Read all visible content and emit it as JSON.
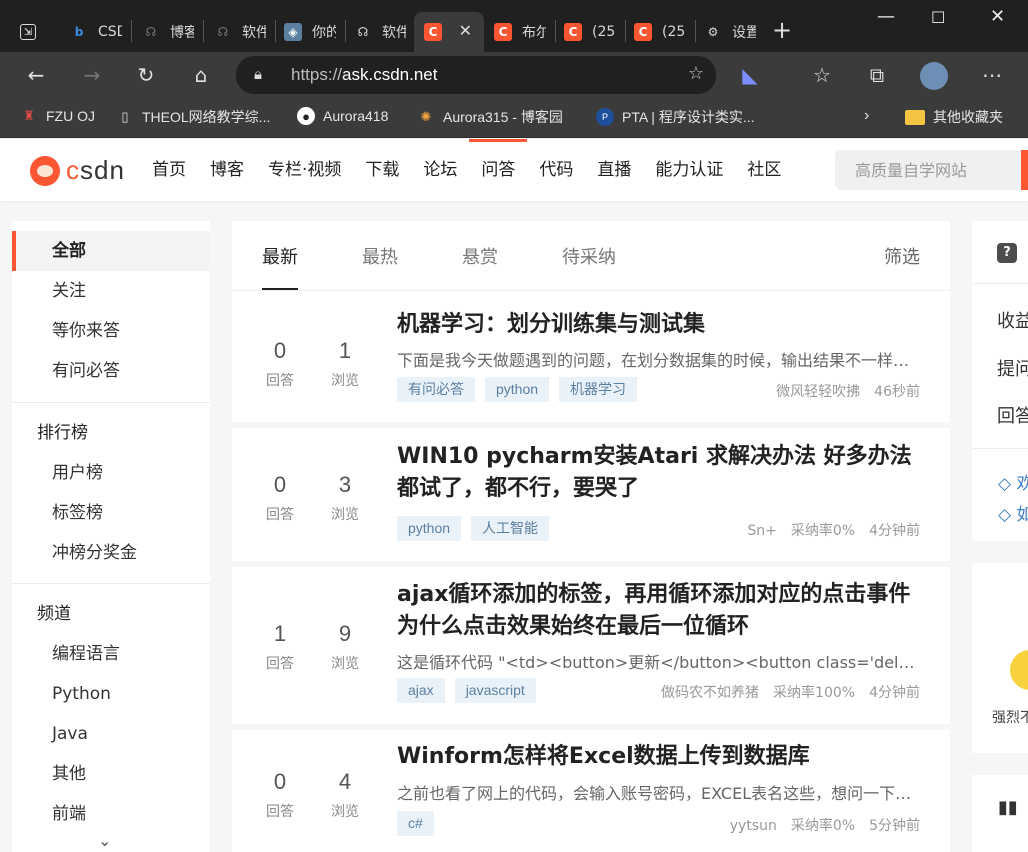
{
  "browser": {
    "tabs": [
      {
        "icon": "window-icon",
        "title": ""
      },
      {
        "icon": "bing-icon",
        "title": "CSDN"
      },
      {
        "icon": "cnblogs-icon",
        "title": "博客园"
      },
      {
        "icon": "cnblogs-icon",
        "title": "软件"
      },
      {
        "icon": "image-icon",
        "title": "你的"
      },
      {
        "icon": "cnblogs-icon",
        "title": "软件"
      },
      {
        "icon": "csdn-icon",
        "title": ""
      },
      {
        "icon": "csdn-icon",
        "title": "布尔"
      },
      {
        "icon": "csdn-icon",
        "title": "(25"
      },
      {
        "icon": "csdn-icon",
        "title": "(25"
      },
      {
        "icon": "gear-icon",
        "title": "设置"
      }
    ],
    "url_host": "ask.csdn.net",
    "url_scheme": "https://",
    "bookmarks": [
      {
        "icon": "fzu-icon",
        "label": "FZU OJ"
      },
      {
        "icon": "page-icon",
        "label": "THEOL网络教学综..."
      },
      {
        "icon": "github-icon",
        "label": "Aurora418"
      },
      {
        "icon": "cnblogs-icon",
        "label": "Aurora315 - 博客园"
      },
      {
        "icon": "pta-icon",
        "label": "PTA | 程序设计类实..."
      },
      {
        "icon": "folder-icon",
        "label": "其他收藏夹"
      }
    ]
  },
  "site": {
    "logo_text": "CSDN",
    "nav": [
      "首页",
      "博客",
      "专栏·视频",
      "下载",
      "论坛",
      "问答",
      "代码",
      "直播",
      "能力认证",
      "社区"
    ],
    "active_nav": "问答",
    "search_placeholder": "高质量自学网站",
    "accent": "#fc5531"
  },
  "sidebar": {
    "group1": [
      "全部",
      "关注",
      "等你来答",
      "有问必答"
    ],
    "ranking_title": "排行榜",
    "ranking": [
      "用户榜",
      "标签榜",
      "冲榜分奖金"
    ],
    "channel_title": "频道",
    "channels": [
      "编程语言",
      "Python",
      "Java",
      "其他",
      "前端"
    ]
  },
  "main": {
    "tabs": [
      "最新",
      "最热",
      "悬赏",
      "待采纳"
    ],
    "filter": "筛选",
    "answers_label": "回答",
    "views_label": "浏览",
    "questions": [
      {
        "answers": "0",
        "views": "1",
        "title": "机器学习：划分训练集与测试集",
        "desc": "下面是我今天做题遇到的问题，在划分数据集的时候，输出结果不一样，请问这是为什么",
        "tags": [
          "有问必答",
          "python",
          "机器学习"
        ],
        "author": "微风轻轻吹拂",
        "rate": "",
        "time": "46秒前"
      },
      {
        "answers": "0",
        "views": "3",
        "title": "WIN10 pycharm安装Atari 求解决办法 好多办法都试了，都不行，要哭了",
        "desc": "",
        "tags": [
          "python",
          "人工智能"
        ],
        "author": "Sn+",
        "rate": "采纳率0%",
        "time": "4分钟前"
      },
      {
        "answers": "1",
        "views": "9",
        "title": "ajax循环添加的标签，再用循环添加对应的点击事件为什么点击效果始终在最后一位循环",
        "desc": "这是循环代码 \"<td><button>更新</button><button class='deleteItem'>删除</button></td>\"",
        "tags": [
          "ajax",
          "javascript"
        ],
        "author": "做码农不如养猪",
        "rate": "采纳率100%",
        "time": "4分钟前"
      },
      {
        "answers": "0",
        "views": "4",
        "title": "Winform怎样将Excel数据上传到数据库",
        "desc": "之前也看了网上的代码，会输入账号密码，EXCEL表名这些，想问一下具体怎么做",
        "tags": [
          "c#"
        ],
        "author": "yytsun",
        "rate": "采纳率0%",
        "time": "5分钟前"
      }
    ]
  },
  "right": {
    "items": [
      "收益",
      "提问",
      "回答"
    ],
    "links": [
      "◇ 欢",
      "◇ 如"
    ],
    "badge_text": "强烈不"
  }
}
